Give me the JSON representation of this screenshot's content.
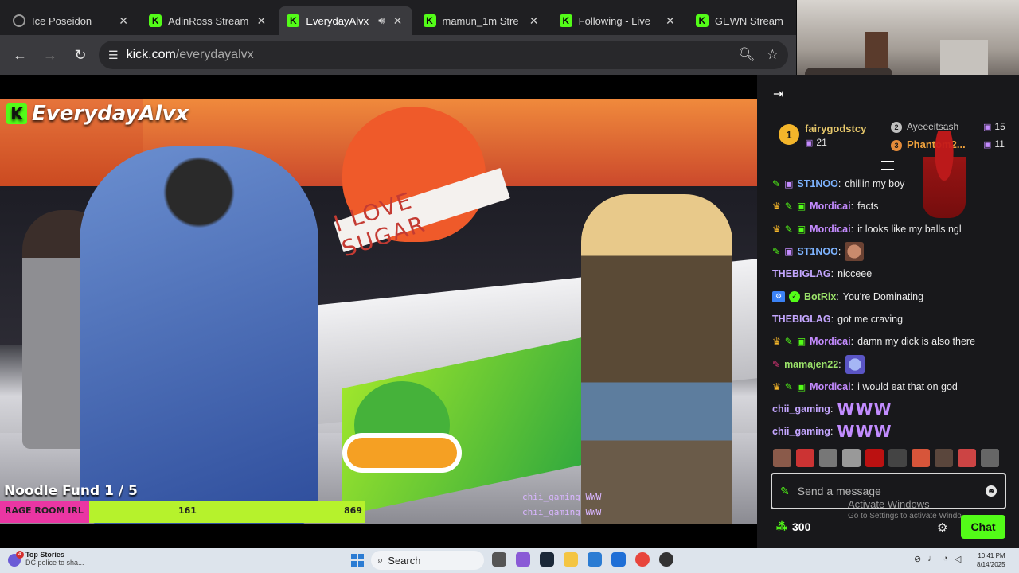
{
  "browser": {
    "tabs": [
      {
        "title": "Ice Poseidon",
        "favicon": "globe-icon",
        "active": false
      },
      {
        "title": "AdinRoss Stream",
        "favicon": "kick-icon",
        "active": false
      },
      {
        "title": "EverydayAlvx",
        "favicon": "kick-icon",
        "active": true,
        "audio": true
      },
      {
        "title": "mamun_1m Stre",
        "favicon": "kick-icon",
        "active": false
      },
      {
        "title": "Following - Live",
        "favicon": "kick-icon",
        "active": false
      },
      {
        "title": "GEWN Stream",
        "favicon": "kick-icon",
        "active": false
      }
    ],
    "close_glyph": "✕",
    "url_host": "kick.com",
    "url_path": "/everydayalvx"
  },
  "player": {
    "channel_name": "EverydayAlvx",
    "store_sign": "I LOVE SUGAR",
    "fund_label": "Noodle Fund  1 / 5",
    "fund_bar_left": "RAGE ROOM IRL",
    "fund_bar_mid": "161",
    "fund_bar_right": "869",
    "fund_progress_fraction": 0.245,
    "overlay_chat": [
      "chii_gaming WWW",
      "chii_gaming WWW"
    ]
  },
  "chat": {
    "leaderboard": {
      "first_rank": "1",
      "first_name": "fairygodstcy",
      "first_count": "21",
      "second_name": "Ayeeeitsash",
      "second_count": "15",
      "third_rank": "3",
      "third_name": "Phantom2...",
      "third_count": "11"
    },
    "messages": [
      {
        "user": "ST1NOO",
        "color": "#7db3ff",
        "badges": [
          "brush",
          "gift-purple"
        ],
        "text": "chillin my boy"
      },
      {
        "user": "Mordicai",
        "color": "#c48bff",
        "badges": [
          "crown",
          "brush",
          "gift"
        ],
        "text": "facts"
      },
      {
        "user": "Mordicai",
        "color": "#c48bff",
        "badges": [
          "crown",
          "brush",
          "gift"
        ],
        "text": "it looks like my balls ngl"
      },
      {
        "user": "ST1NOO",
        "color": "#7db3ff",
        "badges": [
          "brush",
          "gift-purple"
        ],
        "text": "",
        "emote": "face"
      },
      {
        "user": "THEBIGLAG",
        "color": "#c4a6ff",
        "badges": [],
        "text": "nicceee"
      },
      {
        "user": "BotRix",
        "color": "#9be36a",
        "badges": [
          "bot",
          "verified"
        ],
        "text": "You're Dominating"
      },
      {
        "user": "THEBIGLAG",
        "color": "#c4a6ff",
        "badges": [],
        "text": "got me craving"
      },
      {
        "user": "Mordicai",
        "color": "#c48bff",
        "badges": [
          "crown",
          "brush",
          "gift"
        ],
        "text": "damn my dick is also there"
      },
      {
        "user": "mamajen22",
        "color": "#9be36a",
        "badges": [
          "brush-pink"
        ],
        "text": "",
        "emote": "globe"
      },
      {
        "user": "Mordicai",
        "color": "#c48bff",
        "badges": [
          "crown",
          "brush",
          "gift"
        ],
        "text": "i would eat that on god"
      },
      {
        "user": "chii_gaming",
        "color": "#c4a6ff",
        "badges": [],
        "text": "",
        "www": "WWW"
      },
      {
        "user": "chii_gaming",
        "color": "#c4a6ff",
        "badges": [],
        "text": "",
        "www": "WWW"
      }
    ],
    "avatar_colors": [
      "#8a5a4a",
      "#c33",
      "#777",
      "#999",
      "#b11",
      "#444",
      "#d7553a",
      "#5a463c",
      "#c44",
      "#666"
    ],
    "input_placeholder": "Send a message",
    "watermark_title": "Activate Windows",
    "watermark_sub": "Go to Settings to activate Windo",
    "points": "300",
    "chat_button": "Chat"
  },
  "taskbar": {
    "news_title": "Top Stories",
    "news_sub": "DC police to sha...",
    "search_label": "Search",
    "time": "10:41 PM",
    "date": "8/14/2025"
  },
  "colors": {
    "kick_green": "#53fc18",
    "chat_bg": "#18181b"
  }
}
